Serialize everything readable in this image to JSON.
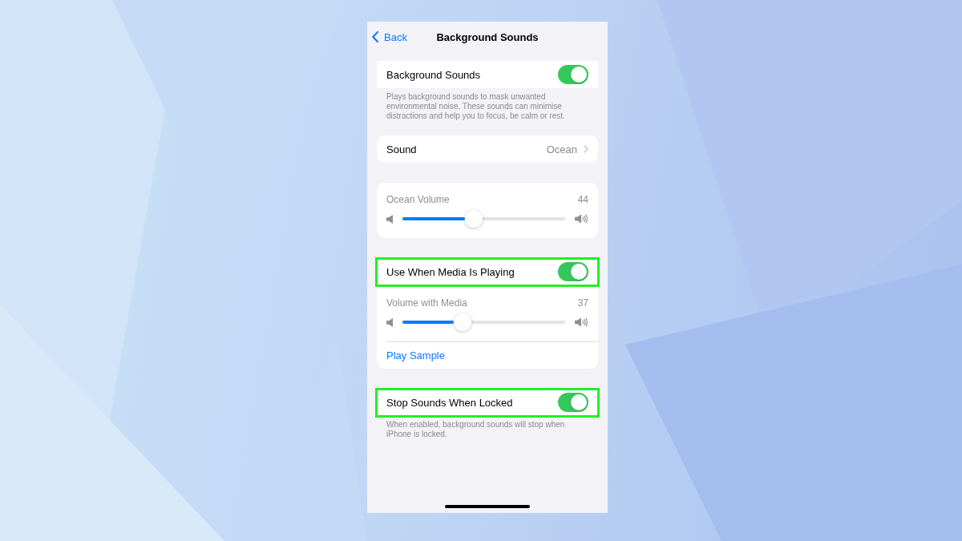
{
  "nav": {
    "back": "Back",
    "title": "Background Sounds"
  },
  "sections": [
    {
      "rows": [
        {
          "kind": "toggle",
          "label": "Background Sounds",
          "on": true,
          "highlighted": false
        }
      ],
      "footer": "Plays background sounds to mask unwanted environmental noise. These sounds can minimise distractions and help you to focus, be calm or rest."
    },
    {
      "rows": [
        {
          "kind": "link",
          "label": "Sound",
          "value": "Ocean"
        }
      ]
    },
    {
      "rows": [
        {
          "kind": "slider",
          "label": "Ocean Volume",
          "reading": "44",
          "level": 0.44
        }
      ]
    },
    {
      "rows": [
        {
          "kind": "toggle",
          "label": "Use When Media Is Playing",
          "on": true,
          "highlighted": true
        },
        {
          "kind": "slider",
          "label": "Volume with Media",
          "reading": "37",
          "level": 0.37
        },
        {
          "kind": "action",
          "label": "Play Sample"
        }
      ]
    },
    {
      "rows": [
        {
          "kind": "toggle",
          "label": "Stop Sounds When Locked",
          "on": true,
          "highlighted": true
        }
      ],
      "footer": "When enabled, background sounds will stop when iPhone is locked."
    }
  ]
}
